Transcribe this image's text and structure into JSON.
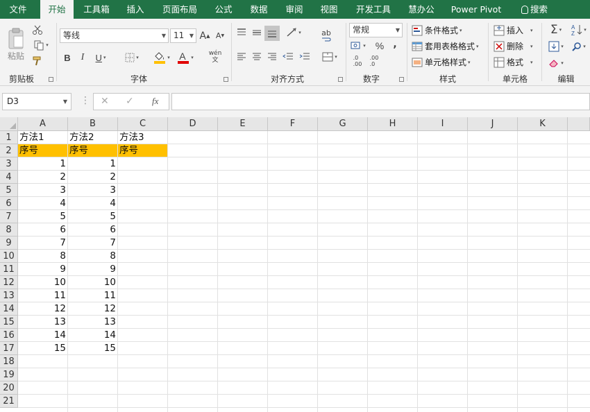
{
  "tabs": [
    "文件",
    "开始",
    "工具箱",
    "插入",
    "页面布局",
    "公式",
    "数据",
    "审阅",
    "视图",
    "开发工具",
    "慧办公",
    "Power Pivot",
    "搜索"
  ],
  "active_tab": "开始",
  "clipboard": {
    "paste_label": "粘贴",
    "group_label": "剪贴板"
  },
  "font": {
    "name": "等线",
    "size": "11",
    "group_label": "字体",
    "bold": "B",
    "italic": "I",
    "underline": "U",
    "grow": "A",
    "shrink": "A",
    "font_color_letter": "A",
    "phonetic": "wén\n文",
    "fill_color": "#ffc000",
    "text_color": "#e00000"
  },
  "alignment": {
    "group_label": "对齐方式",
    "wrap_icon": "ab"
  },
  "number": {
    "format": "常规",
    "group_label": "数字",
    "percent": "%",
    "comma": ",",
    "inc_decimal": ".0\n.00",
    "dec_decimal": ".00\n.0"
  },
  "styles": {
    "group_label": "样式",
    "conditional": "条件格式",
    "table_format": "套用表格格式",
    "cell_styles": "单元格样式"
  },
  "cells": {
    "group_label": "单元格",
    "insert": "插入",
    "delete": "删除",
    "format": "格式"
  },
  "editing": {
    "group_label": "编辑",
    "sum": "Σ"
  },
  "formula_bar": {
    "name_box": "D3",
    "cancel": "✕",
    "enter": "✓",
    "fx": "fx",
    "content": ""
  },
  "columns": [
    "A",
    "B",
    "C",
    "D",
    "E",
    "F",
    "G",
    "H",
    "I",
    "J",
    "K"
  ],
  "rows": [
    "1",
    "2",
    "3",
    "4",
    "5",
    "6",
    "7",
    "8",
    "9",
    "10",
    "11",
    "12",
    "13",
    "14",
    "15",
    "16",
    "17",
    "18",
    "19",
    "20",
    "21"
  ],
  "sheet": {
    "row1": [
      "方法1",
      "方法2",
      "方法3"
    ],
    "row2": [
      "序号",
      "序号",
      "序号"
    ],
    "row2_fill": "#ffc000",
    "col_a_values": [
      "1",
      "2",
      "3",
      "4",
      "5",
      "6",
      "7",
      "8",
      "9",
      "10",
      "11",
      "12",
      "13",
      "14",
      "15"
    ],
    "col_b_values": [
      "1",
      "2",
      "3",
      "4",
      "5",
      "6",
      "7",
      "8",
      "9",
      "10",
      "11",
      "12",
      "13",
      "14",
      "15"
    ]
  },
  "colors": {
    "accent": "#217346"
  }
}
